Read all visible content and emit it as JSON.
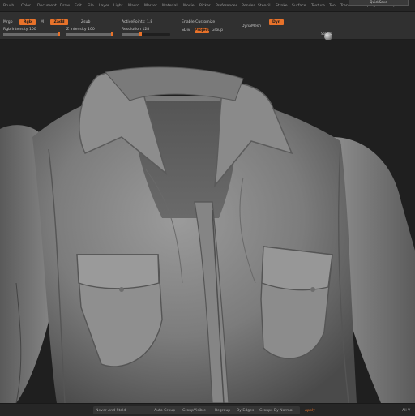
{
  "menubar": {
    "items": [
      "Brush",
      "Color",
      "Document",
      "Draw",
      "Edit",
      "File",
      "Layer",
      "Light",
      "Macro",
      "Marker",
      "Material",
      "Movie",
      "Picker",
      "Preferences",
      "Render",
      "Stencil",
      "Stroke",
      "Surface",
      "Texture",
      "Tool",
      "Transform",
      "Zplugin",
      "Zscript"
    ],
    "quicksave": "QuickSave"
  },
  "toolbar": {
    "mrgb_label": "Mrgb",
    "rgb_label": "Rgb",
    "m_label": "M",
    "zadd_label": "Zadd",
    "zsub_label": "Zsub",
    "rgb_intensity_label": "Rgb Intensity 100",
    "z_intensity_label": "Z Intensity 100",
    "active_points_label": "ActivePoints: 1.8",
    "resolution_label": "Resolution 128",
    "enable_customize_label": "Enable Customize",
    "sdiv_label": "SDiv",
    "project_label": "Project",
    "group_label": "Group",
    "dynamesh_label": "DynaMesh",
    "dyn_label": "Dyn",
    "solo_label": "Solo_D",
    "accent_color": "#e8722a"
  },
  "viewport": {
    "subject_icon": "shirt-model"
  },
  "bottombar": {
    "items": [
      {
        "label": "Never And Stold",
        "highlight": false
      },
      {
        "label": "Auto Group",
        "highlight": false
      },
      {
        "label": "GroupVisible",
        "highlight": false
      },
      {
        "label": "Regroup",
        "highlight": false
      },
      {
        "label": "By Edges",
        "highlight": false
      },
      {
        "label": "Groups By Normal",
        "highlight": false
      },
      {
        "label": "Apply",
        "highlight": true
      }
    ],
    "all_label": "All V"
  }
}
